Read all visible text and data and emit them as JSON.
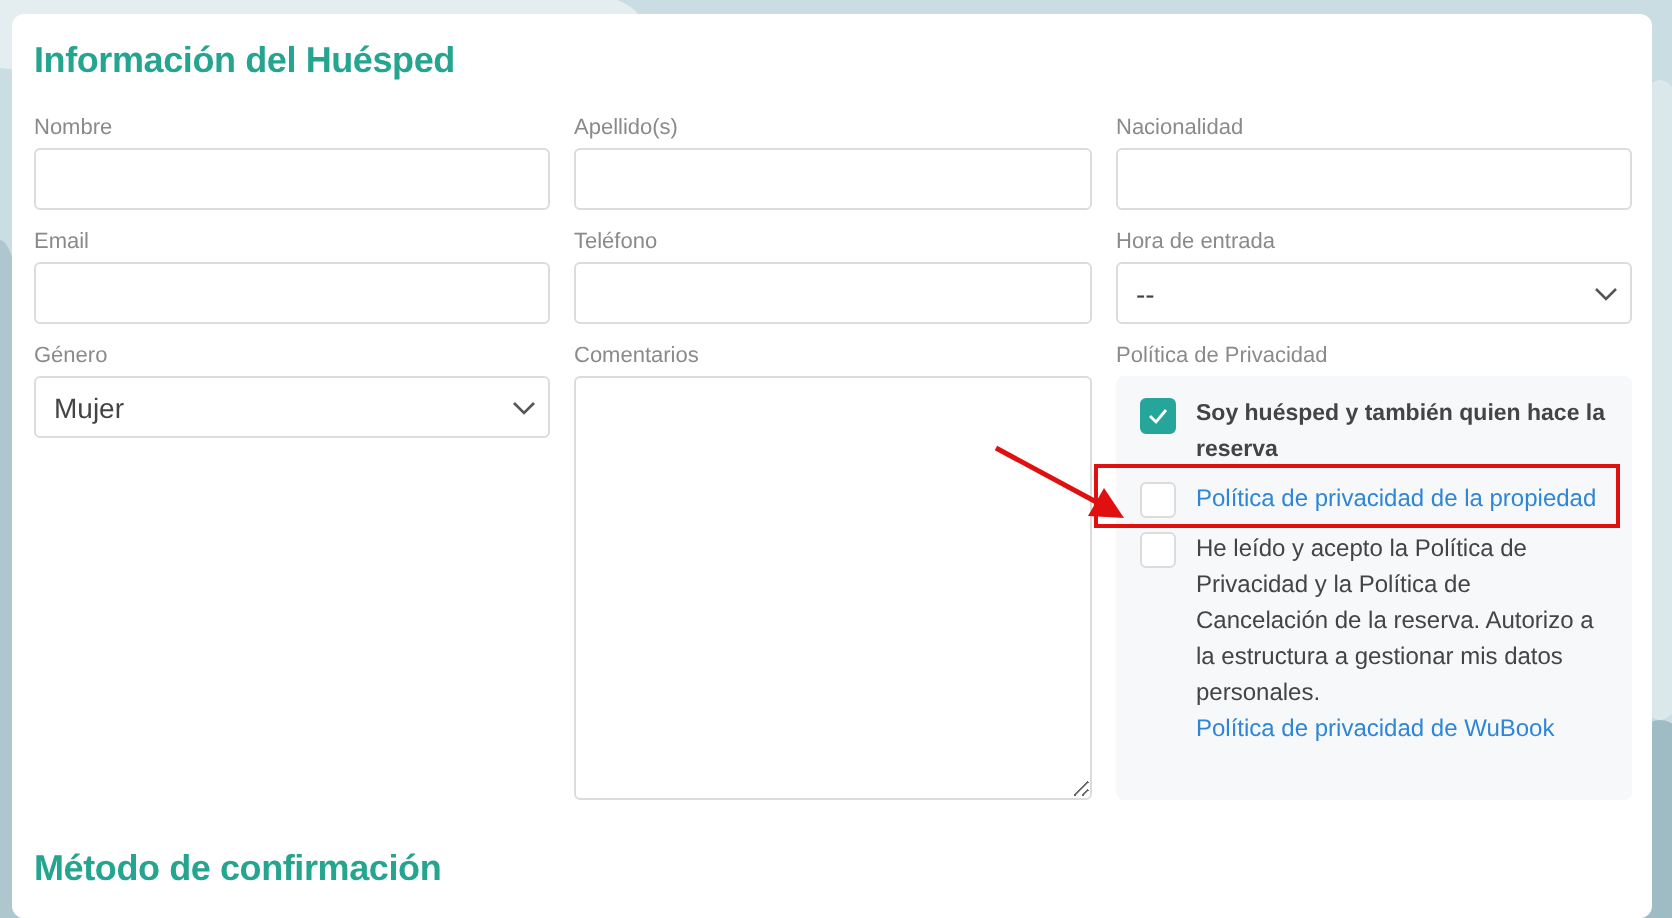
{
  "section_title": "Información del Huésped",
  "fields": [
    {
      "kind": "input",
      "label": "Nombre"
    },
    {
      "kind": "input",
      "label": "Apellido(s)"
    },
    {
      "kind": "input",
      "label": "Nacionalidad"
    },
    {
      "kind": "input",
      "label": "Email"
    },
    {
      "kind": "input",
      "label": "Teléfono"
    },
    {
      "kind": "select",
      "label": "Hora de entrada",
      "value": "--"
    },
    {
      "kind": "select",
      "label": "Género",
      "value": "Mujer"
    },
    {
      "kind": "textarea",
      "label": "Comentarios"
    }
  ],
  "privacy": {
    "label": "Política de Privacidad",
    "items": [
      {
        "checked": true,
        "bold": true,
        "text": "Soy huésped y también quien hace la reserva"
      },
      {
        "checked": false,
        "bold": false,
        "link": "Política de privacidad de la propiedad"
      },
      {
        "checked": false,
        "bold": false,
        "text": "He leído y acepto la Política de Privacidad y la Política de Cancelación de la reserva. Autorizo a la estructura a gestionar mis datos personales.",
        "link": "Política de privacidad de WuBook"
      }
    ]
  },
  "next_section_title": "Método de confirmación"
}
